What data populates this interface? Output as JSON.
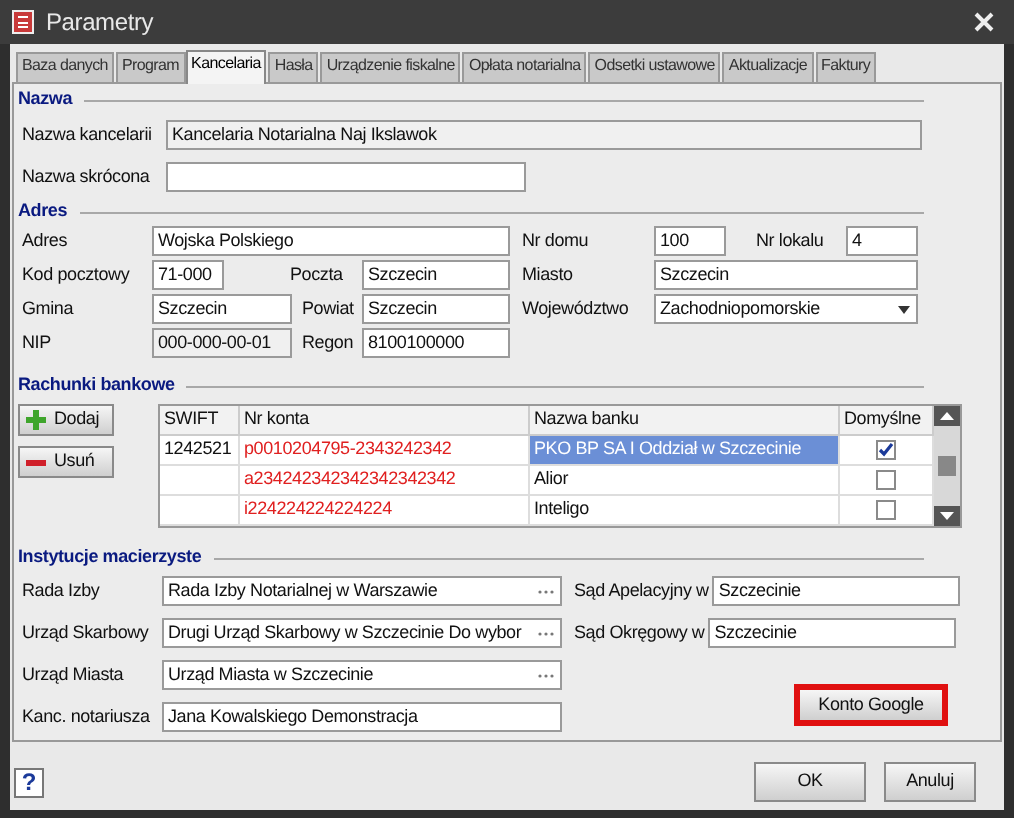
{
  "window": {
    "title": "Parametry"
  },
  "tabs": [
    {
      "label": "Baza danych",
      "selected": false
    },
    {
      "label": "Program",
      "selected": false
    },
    {
      "label": "Kancelaria",
      "selected": true
    },
    {
      "label": "Hasła",
      "selected": false
    },
    {
      "label": "Urządzenie fiskalne",
      "selected": false
    },
    {
      "label": "Opłata notarialna",
      "selected": false
    },
    {
      "label": "Odsetki ustawowe",
      "selected": false
    },
    {
      "label": "Aktualizacje",
      "selected": false
    },
    {
      "label": "Faktury",
      "selected": false
    }
  ],
  "nazwa": {
    "title": "Nazwa",
    "rows": [
      [
        {
          "label": "Nazwa kancelarii",
          "value": "Kancelaria Notarialna Naj Ikslawok",
          "kind": "readonly"
        }
      ],
      [
        {
          "label": "Nazwa skrócona",
          "kind": "text"
        }
      ]
    ]
  },
  "adres": {
    "title": "Adres",
    "rows": [
      [
        {
          "label": "Adres",
          "value": "Wojska Polskiego",
          "kind": "text"
        },
        null,
        {
          "label": "Nr domu",
          "value": "100",
          "kind": "text"
        },
        {
          "label": "Nr lokalu",
          "value": "4",
          "kind": "text"
        }
      ],
      [
        {
          "label": "Kod pocztowy",
          "value": "71-000",
          "kind": "text"
        },
        {
          "label": "Poczta",
          "value": "Szczecin",
          "kind": "text"
        },
        {
          "label": "Miasto",
          "value": "Szczecin",
          "kind": "text"
        }
      ],
      [
        {
          "label": "Gmina",
          "value": "Szczecin",
          "kind": "text"
        },
        {
          "label": "Powiat",
          "value": "Szczecin",
          "kind": "text"
        },
        {
          "label": "Województwo",
          "value": "Zachodniopomorskie",
          "kind": "dropdown"
        }
      ],
      [
        {
          "label": "NIP",
          "value": "000-000-00-01",
          "kind": "readonly"
        },
        {
          "label": "Regon",
          "value": "8100100000",
          "kind": "text"
        }
      ]
    ]
  },
  "rachunki": {
    "title": "Rachunki bankowe",
    "buttons": [
      {
        "label": "Dodaj",
        "kind": "add"
      },
      {
        "label": "Usuń",
        "kind": "remove"
      }
    ],
    "columns": [
      "SWIFT",
      "Nr konta",
      "Nazwa banku",
      "Domyślne"
    ],
    "rows": [
      {
        "swift": "1242521",
        "account": "p0010204795-2343242342",
        "bank": "PKO BP SA I Oddział w Szczecinie",
        "checked": true,
        "selected": true
      },
      {
        "account": "a234242342342342342342",
        "bank": "Alior",
        "checked": false,
        "selected": false
      },
      {
        "account": "i224224224224224",
        "bank": "Inteligo",
        "checked": false,
        "selected": false
      }
    ]
  },
  "instytucje": {
    "title": "Instytucje macierzyste",
    "left": [
      {
        "label": "Rada Izby",
        "value": "Rada Izby Notarialnej w Warszawie",
        "kind": "picker"
      },
      {
        "label": "Urząd Skarbowy",
        "value": "Drugi Urząd Skarbowy w Szczecinie Do wybor",
        "kind": "picker"
      },
      {
        "label": "Urząd Miasta",
        "value": "Urząd Miasta w Szczecinie",
        "kind": "picker"
      },
      {
        "label": "Kanc. notariusza",
        "value": "Jana Kowalskiego Demonstracja",
        "kind": "text"
      }
    ],
    "right": [
      {
        "label": "Sąd Apelacyjny w",
        "value": "Szczecinie",
        "kind": "text"
      },
      {
        "label": "Sąd Okręgowy w",
        "value": "Szczecinie",
        "kind": "text"
      }
    ],
    "button": {
      "label": "Konto Google",
      "highlighted": true
    }
  },
  "footer": {
    "help": "?",
    "buttons": [
      "OK",
      "Anuluj"
    ]
  }
}
